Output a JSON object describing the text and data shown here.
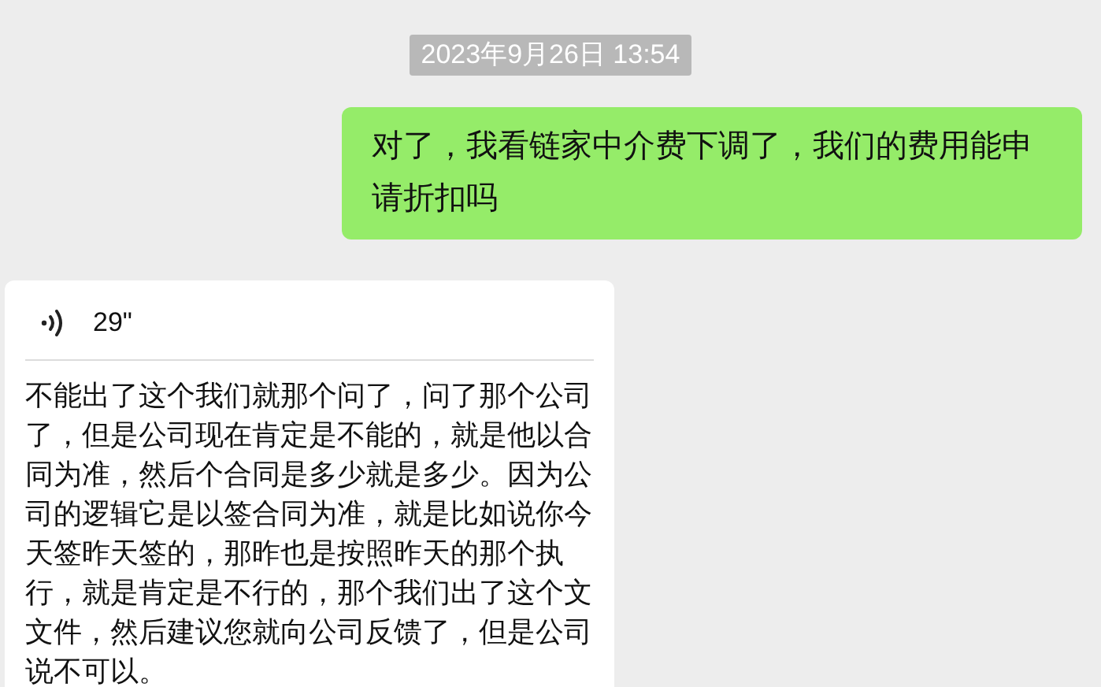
{
  "timestamp": "2023年9月26日 13:54",
  "messages": [
    {
      "kind": "text",
      "text": "对了，我看链家中介费下调了，我们的费用能申请折扣吗"
    },
    {
      "kind": "voice",
      "duration": "29\"",
      "transcript": "不能出了这个我们就那个问了，问了那个公司了，但是公司现在肯定是不能的，就是他以合同为准，然后个合同是多少就是多少。因为公司的逻辑它是以签合同为准，就是比如说你今天签昨天签的，那昨也是按照昨天的那个执行，就是肯定是不行的，那个我们出了这个文文件，然后建议您就向公司反馈了，但是公司说不可以。"
    }
  ]
}
